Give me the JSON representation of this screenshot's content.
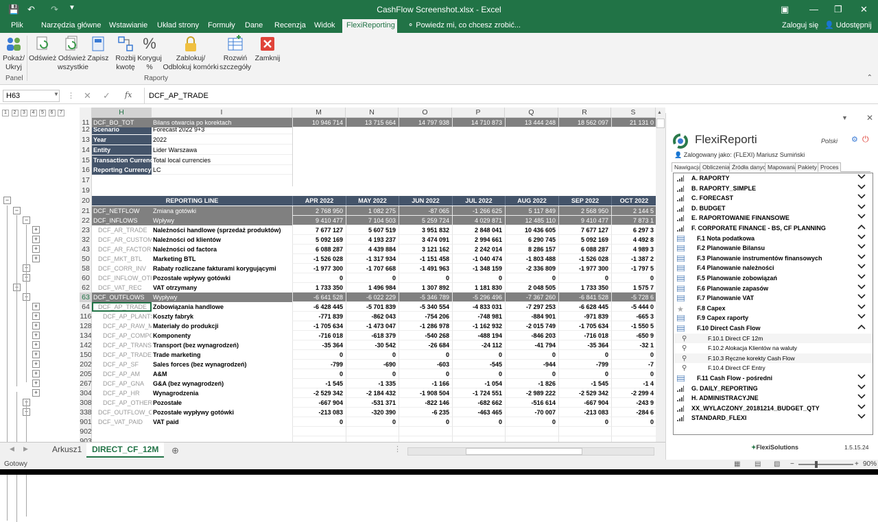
{
  "window": {
    "title": "CashFlow Screenshot.xlsx - Excel"
  },
  "ribbon_tabs": [
    "Plik",
    "Narzędzia główne",
    "Wstawianie",
    "Układ strony",
    "Formuły",
    "Dane",
    "Recenzja",
    "Widok",
    "FlexiReporting"
  ],
  "tell_me": "Powiedz mi, co chcesz zrobić...",
  "sign_in": "Zaloguj się",
  "share": "Udostępnij",
  "ribbon_buttons": [
    {
      "l1": "Pokaż/",
      "l2": "Ukryj"
    },
    {
      "l1": "Odśwież",
      "l2": ""
    },
    {
      "l1": "Odśwież",
      "l2": "wszystkie"
    },
    {
      "l1": "Zapisz",
      "l2": ""
    },
    {
      "l1": "Rozbij",
      "l2": "kwotę"
    },
    {
      "l1": "Koryguj",
      "l2": "%"
    },
    {
      "l1": "Zablokuj/",
      "l2": "Odblokuj komórki"
    },
    {
      "l1": "Rozwiń",
      "l2": "szczegóły"
    },
    {
      "l1": "Zamknij",
      "l2": ""
    }
  ],
  "groups": {
    "panel": "Panel",
    "raporty": "Raporty"
  },
  "formula": {
    "namebox": "H63",
    "fx": "fx",
    "value": "DCF_AP_TRADE"
  },
  "outline_levels": [
    "1",
    "2",
    "3",
    "4",
    "5",
    "6",
    "7"
  ],
  "columns": [
    "G",
    "H",
    "I",
    "M",
    "N",
    "O",
    "P",
    "Q",
    "R",
    "S"
  ],
  "info": [
    {
      "row": "12",
      "label": "Scenario",
      "value": "Forecast 2022 9+3"
    },
    {
      "row": "13",
      "label": "Year",
      "value": "2022"
    },
    {
      "row": "14",
      "label": "Entity",
      "value": "Lider Warszawa"
    },
    {
      "row": "15",
      "label": "Transaction Currency",
      "value": "Total local currencies"
    },
    {
      "row": "16",
      "label": "Reporting Currency",
      "value": "LC"
    }
  ],
  "row_numbers": [
    "11",
    "12",
    "13",
    "14",
    "15",
    "16",
    "17",
    "19",
    "20",
    "21",
    "22",
    "23",
    "32",
    "43",
    "50",
    "58",
    "60",
    "62",
    "63",
    "64",
    "116",
    "128",
    "134",
    "142",
    "150",
    "202",
    "205",
    "267",
    "304",
    "308",
    "338",
    "901",
    "902",
    "903"
  ],
  "header_row": {
    "label": "REPORTING LINE",
    "months": [
      "APR 2022",
      "MAY 2022",
      "JUN 2022",
      "JUL 2022",
      "AUG 2022",
      "SEP 2022",
      "OCT 2022"
    ]
  },
  "rows": [
    {
      "code": "DCF_NETFLOW",
      "name": "Zmiana gotówki",
      "v": [
        "2 768 950",
        "1 082 275",
        "-87 065",
        "-1 266 625",
        "5 117 849",
        "2 568 950",
        "2 144 5"
      ],
      "style": "grey"
    },
    {
      "code": "DCF_INFLOWS",
      "name": "Wpływy",
      "v": [
        "9 410 477",
        "7 104 503",
        "5 259 724",
        "4 029 871",
        "12 485 110",
        "9 410 477",
        "7 873 1"
      ],
      "style": "grey"
    },
    {
      "code": "DCF_AR_TRADE",
      "name": "Należności handlowe (sprzedaż produktów)",
      "v": [
        "7 677 127",
        "5 607 519",
        "3 951 832",
        "2 848 041",
        "10 436 605",
        "7 677 127",
        "6 297 3"
      ]
    },
    {
      "code": "DCF_AR_CUSTOM",
      "name": "Należności od klientów",
      "v": [
        "5 092 169",
        "4 193 237",
        "3 474 091",
        "2 994 661",
        "6 290 745",
        "5 092 169",
        "4 492 8"
      ]
    },
    {
      "code": "DCF_AR_FACTOR",
      "name": "Należności od factora",
      "v": [
        "6 088 287",
        "4 439 884",
        "3 121 162",
        "2 242 014",
        "8 286 157",
        "6 088 287",
        "4 989 3"
      ]
    },
    {
      "code": "DCF_MKT_BTL",
      "name": "Marketing BTL",
      "v": [
        "-1 526 028",
        "-1 317 934",
        "-1 151 458",
        "-1 040 474",
        "-1 803 488",
        "-1 526 028",
        "-1 387 2"
      ]
    },
    {
      "code": "DCF_CORR_INV",
      "name": "Rabaty rozliczane fakturami korygującymi",
      "v": [
        "-1 977 300",
        "-1 707 668",
        "-1 491 963",
        "-1 348 159",
        "-2 336 809",
        "-1 977 300",
        "-1 797 5"
      ]
    },
    {
      "code": "DCF_INFLOW_OTH",
      "name": "Pozostałe wpływy gotówki",
      "v": [
        "0",
        "0",
        "0",
        "0",
        "0",
        "0",
        "0"
      ]
    },
    {
      "code": "DCF_VAT_REC",
      "name": "VAT otrzymany",
      "v": [
        "1 733 350",
        "1 496 984",
        "1 307 892",
        "1 181 830",
        "2 048 505",
        "1 733 350",
        "1 575 7"
      ]
    },
    {
      "code": "DCF_OUTFLOWS",
      "name": "Wypływy",
      "v": [
        "-6 641 528",
        "-6 022 229",
        "-5 346 789",
        "-5 296 496",
        "-7 367 260",
        "-6 841 528",
        "-5 728 6"
      ],
      "style": "grey"
    },
    {
      "code": "DCF_AP_TRADE",
      "name": "Zobowiązania handlowe",
      "v": [
        "-6 428 445",
        "-5 701 839",
        "-5 340 554",
        "-4 833 031",
        "-7 297 253",
        "-6 628 445",
        "-5 444 0"
      ]
    },
    {
      "code": "DCF_AP_PLANTS",
      "name": "Koszty fabryk",
      "v": [
        "-771 839",
        "-862 043",
        "-754 206",
        "-748 981",
        "-884 901",
        "-971 839",
        "-665 3"
      ]
    },
    {
      "code": "DCF_AP_RAW_M",
      "name": "Materiały do produkcji",
      "v": [
        "-1 705 634",
        "-1 473 047",
        "-1 286 978",
        "-1 162 932",
        "-2 015 749",
        "-1 705 634",
        "-1 550 5"
      ]
    },
    {
      "code": "DCF_AP_COMPO",
      "name": "Komponenty",
      "v": [
        "-716 018",
        "-618 379",
        "-540 268",
        "-488 194",
        "-846 203",
        "-716 018",
        "-650 9"
      ]
    },
    {
      "code": "DCF_AP_TRANSP",
      "name": "Transport (bez wynagrodzeń)",
      "v": [
        "-35 364",
        "-30 542",
        "-26 684",
        "-24 112",
        "-41 794",
        "-35 364",
        "-32 1"
      ]
    },
    {
      "code": "DCF_AP_TRADE_I",
      "name": "Trade marketing",
      "v": [
        "0",
        "0",
        "0",
        "0",
        "0",
        "0",
        "0"
      ]
    },
    {
      "code": "DCF_AP_SF",
      "name": "Sales forces (bez wynagrodzeń)",
      "v": [
        "-799",
        "-690",
        "-603",
        "-545",
        "-944",
        "-799",
        "-7"
      ]
    },
    {
      "code": "DCF_AP_AM",
      "name": "A&M",
      "v": [
        "0",
        "0",
        "0",
        "0",
        "0",
        "0",
        "0"
      ]
    },
    {
      "code": "DCF_AP_GNA",
      "name": "G&A (bez wynagrodzeń)",
      "v": [
        "-1 545",
        "-1 335",
        "-1 166",
        "-1 054",
        "-1 826",
        "-1 545",
        "-1 4"
      ]
    },
    {
      "code": "DCF_AP_HR",
      "name": "Wynagrodzenia",
      "v": [
        "-2 529 342",
        "-2 184 432",
        "-1 908 504",
        "-1 724 551",
        "-2 989 222",
        "-2 529 342",
        "-2 299 4"
      ]
    },
    {
      "code": "DCF_AP_OTHER",
      "name": "Pozostałe",
      "v": [
        "-667 904",
        "-531 371",
        "-822 146",
        "-682 662",
        "-516 614",
        "-667 904",
        "-243 9"
      ]
    },
    {
      "code": "DCF_OUTFLOW_OT",
      "name": "Pozostałe wypływy gotówki",
      "v": [
        "-213 083",
        "-320 390",
        "-6 235",
        "-463 465",
        "-70 007",
        "-213 083",
        "-284 6"
      ]
    },
    {
      "code": "DCF_VAT_PAID",
      "name": "VAT paid",
      "v": [
        "0",
        "0",
        "0",
        "0",
        "0",
        "0",
        "0"
      ]
    },
    {
      "code": "",
      "name": "",
      "v": [
        "",
        "",
        "",
        "",
        "",
        "",
        ""
      ]
    },
    {
      "code": "",
      "name": "",
      "v": [
        "",
        "",
        "",
        "",
        "",
        "",
        ""
      ]
    },
    {
      "code": "DCF_BO_TOT",
      "name": "Bilans otwarcia po korektach",
      "v": [
        "10 946 714",
        "13 715 664",
        "14 797 938",
        "14 710 873",
        "13 444 248",
        "18 562 097",
        "21 131 0"
      ],
      "style": "grey"
    }
  ],
  "sheet_tabs": [
    "Arkusz1",
    "DIRECT_CF_12M"
  ],
  "status": {
    "text": "Gotowy",
    "zoom": "90%"
  },
  "panel": {
    "title": "FlexiReporti",
    "lang": "Polski",
    "logged": "Zalogowany jako: (FLEXI) Mariusz Sumiński",
    "tabs": [
      "Nawigacja",
      "Obliczenia",
      "Źródła danych",
      "Mapowania",
      "Pakiety",
      "Proces"
    ],
    "items": [
      {
        "label": "A. RAPORTY",
        "icon": "bars-icon",
        "chev": "down",
        "lvl": 0
      },
      {
        "label": "B. RAPORTY_SIMPLE",
        "icon": "bars-icon",
        "chev": "down",
        "lvl": 0
      },
      {
        "label": "C. FORECAST",
        "icon": "bars-icon",
        "chev": "down",
        "lvl": 0
      },
      {
        "label": "D. BUDGET",
        "icon": "bars-icon",
        "chev": "down",
        "lvl": 0
      },
      {
        "label": "E. RAPORTOWANIE FINANSOWE",
        "icon": "bars-icon",
        "chev": "down",
        "lvl": 0
      },
      {
        "label": "F. CORPORATE FINANCE - BS, CF PLANNING",
        "icon": "bars-icon",
        "chev": "up",
        "lvl": 0
      },
      {
        "label": "F.1 Nota podatkowa",
        "icon": "list-icon",
        "chev": "down",
        "lvl": 1
      },
      {
        "label": "F.2 Planowanie Bilansu",
        "icon": "list-icon",
        "chev": "down",
        "lvl": 1
      },
      {
        "label": "F.3 Planowanie instrumentów finansowych",
        "icon": "list-icon",
        "chev": "down",
        "lvl": 1
      },
      {
        "label": "F.4 Planowanie należności",
        "icon": "list-icon",
        "chev": "down",
        "lvl": 1
      },
      {
        "label": "F.5 Planowanie zobowiązań",
        "icon": "list-icon",
        "chev": "down",
        "lvl": 1
      },
      {
        "label": "F.6 Planowanie zapasów",
        "icon": "list-icon",
        "chev": "down",
        "lvl": 1
      },
      {
        "label": "F.7 Planowanie VAT",
        "icon": "list-icon",
        "chev": "down",
        "lvl": 1
      },
      {
        "label": "F.8 Capex",
        "icon": "star-icon",
        "chev": "down",
        "lvl": 1
      },
      {
        "label": "F.9 Capex raporty",
        "icon": "list-icon",
        "chev": "down",
        "lvl": 1
      },
      {
        "label": "F.10 Direct Cash Flow",
        "icon": "list-icon",
        "chev": "up",
        "lvl": 1
      },
      {
        "label": "F.10.1 Direct CF 12m",
        "icon": "search-icon",
        "chev": "",
        "lvl": 2
      },
      {
        "label": "F.10.2 Alokacja Klientów na waluty",
        "icon": "search-icon",
        "chev": "",
        "lvl": 2
      },
      {
        "label": "F.10.3 Ręczne korekty Cash Flow",
        "icon": "search-icon",
        "chev": "",
        "lvl": 2
      },
      {
        "label": "F.10.4 Direct CF Entry",
        "icon": "search-icon",
        "chev": "",
        "lvl": 2
      },
      {
        "label": "F.11 Cash Flow - pośredni",
        "icon": "list-icon",
        "chev": "down",
        "lvl": 1
      },
      {
        "label": "G. DAILY_REPORTING",
        "icon": "bars-icon",
        "chev": "down",
        "lvl": 0
      },
      {
        "label": "H. ADMINISTRACYJNE",
        "icon": "bars-icon",
        "chev": "down",
        "lvl": 0
      },
      {
        "label": "XX_WYLACZONY_20181214_BUDGET_QTY",
        "icon": "bars-icon",
        "chev": "down",
        "lvl": 0
      },
      {
        "label": "STANDARD_FLEXI",
        "icon": "bars-icon",
        "chev": "down",
        "lvl": 0
      }
    ],
    "footer": "FlexiSolutions",
    "version": "1.5.15.24"
  }
}
